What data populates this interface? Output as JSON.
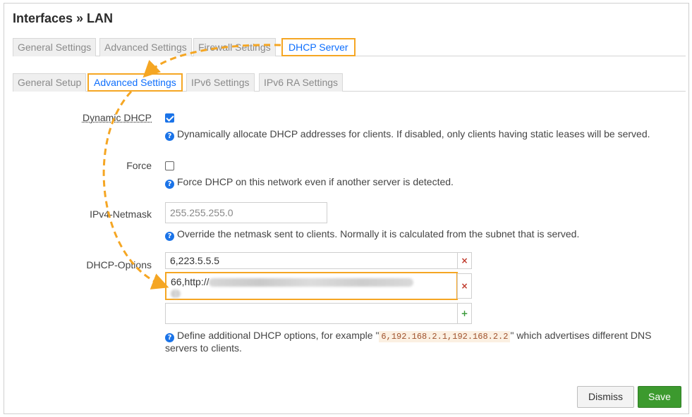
{
  "title": "Interfaces » LAN",
  "main_tabs": [
    {
      "label": "General Settings"
    },
    {
      "label": "Advanced Settings"
    },
    {
      "label": "Firewall Settings"
    },
    {
      "label": "DHCP Server"
    }
  ],
  "sub_tabs": [
    {
      "label": "General Setup"
    },
    {
      "label": "Advanced Settings"
    },
    {
      "label": "IPv6 Settings"
    },
    {
      "label": "IPv6 RA Settings"
    }
  ],
  "fields": {
    "dynamic_dhcp": {
      "label": "Dynamic DHCP",
      "checked": true,
      "help": "Dynamically allocate DHCP addresses for clients. If disabled, only clients having static leases will be served."
    },
    "force": {
      "label": "Force",
      "checked": false,
      "help": "Force DHCP on this network even if another server is detected."
    },
    "netmask": {
      "label": "IPv4-Netmask",
      "placeholder": "255.255.255.0",
      "help": "Override the netmask sent to clients. Normally it is calculated from the subnet that is served."
    },
    "dhcp_options": {
      "label": "DHCP-Options",
      "values": [
        "6,223.5.5.5",
        "66,http://"
      ],
      "help_prefix": "Define additional DHCP options, for example \"",
      "help_code": "6,192.168.2.1,192.168.2.2",
      "help_suffix": "\" which advertises different DNS servers to clients."
    }
  },
  "buttons": {
    "dismiss": "Dismiss",
    "save": "Save",
    "remove_symbol": "×",
    "add_symbol": "+",
    "help_symbol": "?"
  },
  "colors": {
    "highlight": "#f5a623",
    "accent": "#1a73e8",
    "save": "#3c9a2e"
  }
}
